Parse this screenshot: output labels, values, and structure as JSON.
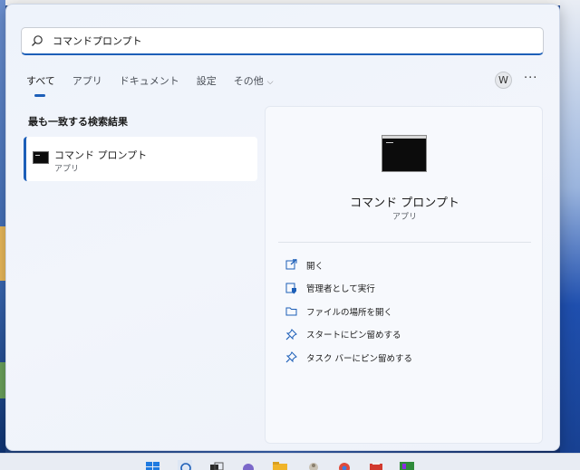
{
  "search": {
    "query": "コマンドプロンプト",
    "placeholder": ""
  },
  "tabs": [
    {
      "label": "すべて",
      "active": true
    },
    {
      "label": "アプリ",
      "active": false
    },
    {
      "label": "ドキュメント",
      "active": false
    },
    {
      "label": "設定",
      "active": false
    },
    {
      "label": "その他",
      "active": false
    }
  ],
  "user_initial": "W",
  "more_label": "···",
  "best_match": {
    "title": "最も一致する検索結果",
    "name": "コマンド プロンプト",
    "type": "アプリ"
  },
  "detail": {
    "name": "コマンド プロンプト",
    "type": "アプリ",
    "actions": [
      {
        "label": "開く",
        "icon": "open-external-icon"
      },
      {
        "label": "管理者として実行",
        "icon": "admin-shield-icon"
      },
      {
        "label": "ファイルの場所を開く",
        "icon": "folder-icon"
      },
      {
        "label": "スタートにピン留めする",
        "icon": "pin-icon"
      },
      {
        "label": "タスク バーにピン留めする",
        "icon": "pin-icon"
      }
    ]
  },
  "colors": {
    "accent": "#1d5fb8",
    "panel_bg": "#eef3fb",
    "terminal_bg": "#0c0c0c"
  }
}
